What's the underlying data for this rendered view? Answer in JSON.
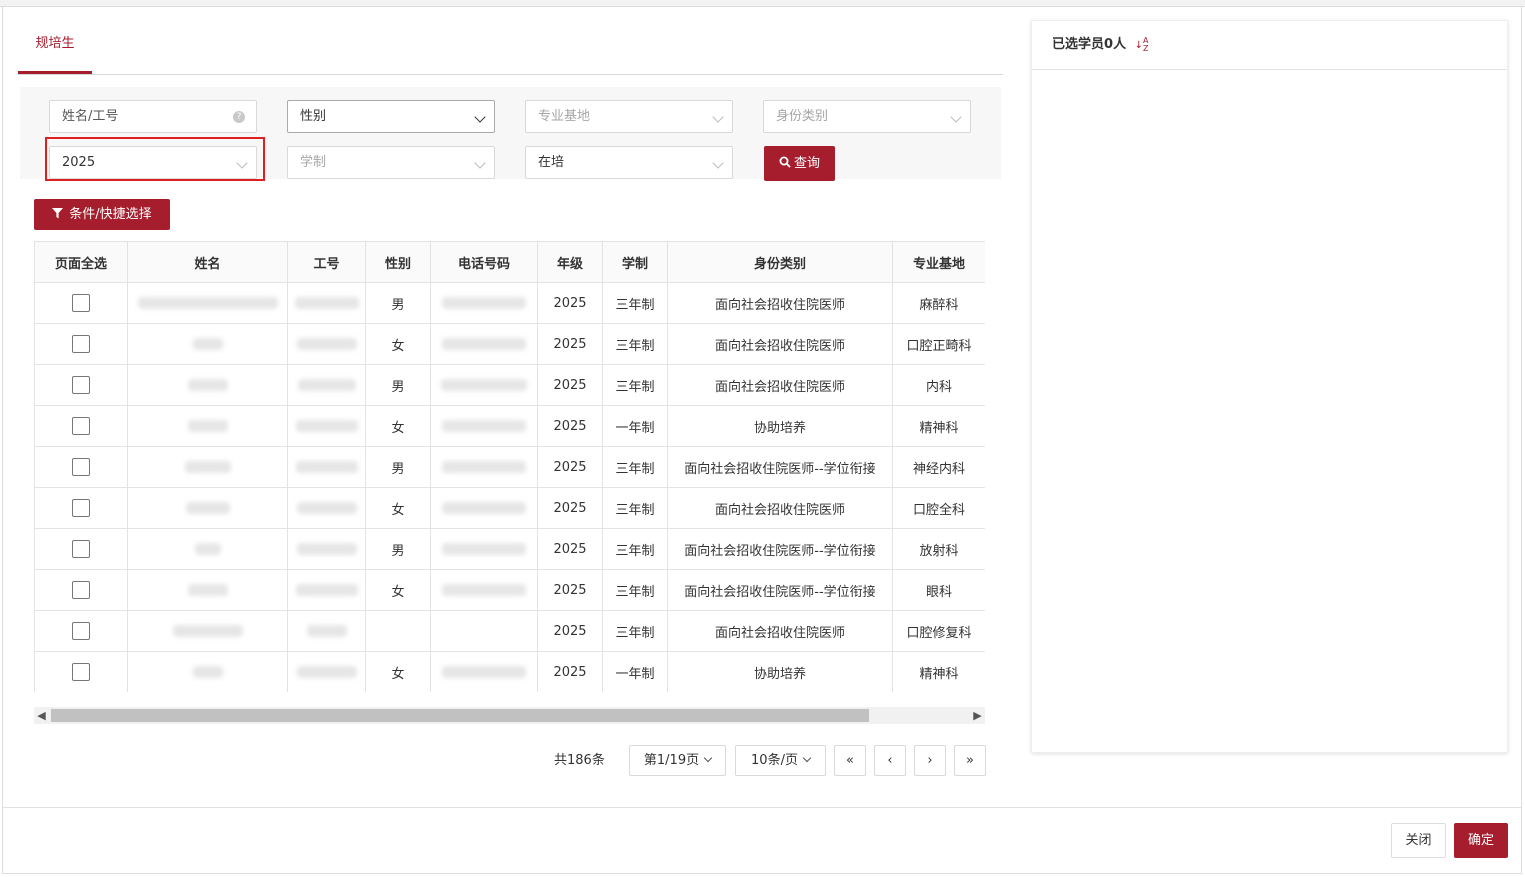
{
  "tabs": [
    {
      "label": "规培生",
      "active": true
    }
  ],
  "filters": {
    "name_placeholder": "姓名/工号",
    "gender_value": "性别",
    "base_placeholder": "专业基地",
    "identity_placeholder": "身份类别",
    "year_value": "2025",
    "duration_placeholder": "学制",
    "status_value": "在培",
    "query_label": "查询",
    "help_glyph": "?"
  },
  "condition_button": "条件/快捷选择",
  "table": {
    "columns": [
      "页面全选",
      "姓名",
      "工号",
      "性别",
      "电话号码",
      "年级",
      "学制",
      "身份类别",
      "专业基地"
    ],
    "rows": [
      {
        "gender": "男",
        "grade": "2025",
        "duration": "三年制",
        "identity": "面向社会招收住院医师",
        "base": "麻醉科"
      },
      {
        "gender": "女",
        "grade": "2025",
        "duration": "三年制",
        "identity": "面向社会招收住院医师",
        "base": "口腔正畸科"
      },
      {
        "gender": "男",
        "grade": "2025",
        "duration": "三年制",
        "identity": "面向社会招收住院医师",
        "base": "内科"
      },
      {
        "gender": "女",
        "grade": "2025",
        "duration": "一年制",
        "identity": "协助培养",
        "base": "精神科"
      },
      {
        "gender": "男",
        "grade": "2025",
        "duration": "三年制",
        "identity": "面向社会招收住院医师--学位衔接",
        "base": "神经内科"
      },
      {
        "gender": "女",
        "grade": "2025",
        "duration": "三年制",
        "identity": "面向社会招收住院医师",
        "base": "口腔全科"
      },
      {
        "gender": "男",
        "grade": "2025",
        "duration": "三年制",
        "identity": "面向社会招收住院医师--学位衔接",
        "base": "放射科"
      },
      {
        "gender": "女",
        "grade": "2025",
        "duration": "三年制",
        "identity": "面向社会招收住院医师--学位衔接",
        "base": "眼科"
      },
      {
        "gender": "",
        "grade": "2025",
        "duration": "三年制",
        "identity": "面向社会招收住院医师",
        "base": "口腔修复科"
      },
      {
        "gender": "女",
        "grade": "2025",
        "duration": "一年制",
        "identity": "协助培养",
        "base": "精神科"
      }
    ]
  },
  "pagination": {
    "total": "共186条",
    "page": "第1/19页",
    "page_size": "10条/页",
    "first": "«",
    "prev": "‹",
    "next": "›",
    "last": "»"
  },
  "selected_panel": {
    "title_prefix": "已选学员",
    "count": "0",
    "unit": "人",
    "sort_top": "A",
    "sort_bottom": "Z"
  },
  "footer": {
    "close_label": "关闭",
    "confirm_label": "确定"
  },
  "colors": {
    "accent": "#a61d2d",
    "highlight": "#e02020"
  }
}
